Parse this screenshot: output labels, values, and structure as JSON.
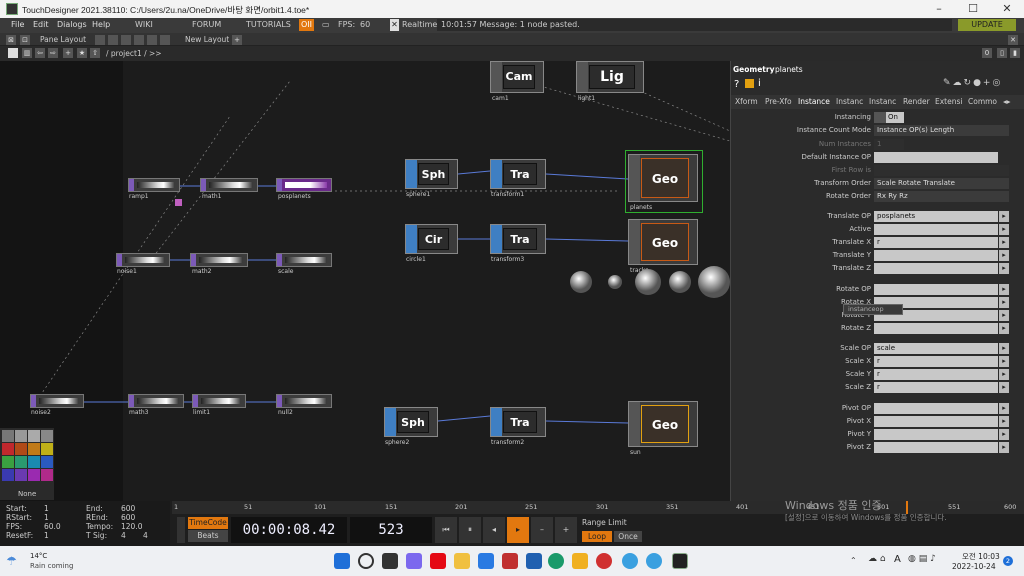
{
  "app": {
    "title": "TouchDesigner 2021.38110: C:/Users/2u.na/OneDrive/바탕 화면/orbit1.4.toe*"
  },
  "menu": {
    "items": [
      "File",
      "Edit",
      "Dialogs",
      "Help"
    ],
    "wiki": "WIKI",
    "forum": "FORUM",
    "tutorials": "TUTORIALS",
    "oii": "OII",
    "fps_label": "FPS:",
    "fps_value": "60",
    "realtime": "Realtime",
    "message": "10:01:57 Message: 1 node pasted.",
    "update": "UPDATE"
  },
  "toolbar": {
    "pane_layout": "Pane Layout",
    "new_layout": "New Layout",
    "path": "/ project1 / >>",
    "zero": "0"
  },
  "nodes": {
    "cam": "Cam",
    "cam_name": "cam1",
    "lig": "Lig",
    "lig_name": "light1",
    "sph1": "Sph",
    "sph1_name": "sphere1",
    "tra1": "Tra",
    "tra1_name": "transform1",
    "geo1": "Geo",
    "geo1_name": "planets",
    "cir": "Cir",
    "cir_name": "circle1",
    "tra3": "Tra",
    "tra3_name": "transform3",
    "geo2": "Geo",
    "geo2_name": "tracks",
    "sph2": "Sph",
    "sph2_name": "sphere2",
    "tra2": "Tra",
    "tra2_name": "transform2",
    "geo3": "Geo",
    "geo3_name": "sun",
    "ramp1": "ramp1",
    "math1": "math1",
    "posplanets": "posplanets",
    "noise1": "noise1",
    "math2": "math2",
    "scale": "scale",
    "noise2": "noise2",
    "math3": "math3",
    "limit1": "limit1",
    "null2": "null2"
  },
  "palette": {
    "none_label": "None"
  },
  "panel": {
    "header_type": "Geometry",
    "header_name": "planets",
    "tabs": [
      "Xform",
      "Pre-Xfo",
      "Instance",
      "Instanc",
      "Instanc",
      "Render",
      "Extensi",
      "Commo"
    ],
    "active_tab": "Instance",
    "params": [
      {
        "label": "Instancing",
        "value": "On"
      },
      {
        "label": "Instance Count Mode",
        "value": "Instance OP(s) Length"
      },
      {
        "label": "Num Instances",
        "value": "1"
      },
      {
        "label": "Default Instance OP",
        "value": ""
      },
      {
        "label": "First Row is",
        "value": ""
      },
      {
        "label": "Transform Order",
        "value": "Scale Rotate Translate"
      },
      {
        "label": "Rotate Order",
        "value": "Rx Ry Rz"
      },
      {
        "label": "Translate OP",
        "value": "posplanets"
      },
      {
        "label": "Active",
        "value": ""
      },
      {
        "label": "Translate X",
        "value": "r"
      },
      {
        "label": "Translate Y",
        "value": ""
      },
      {
        "label": "Translate Z",
        "value": ""
      },
      {
        "label": "Rotate OP",
        "value": ""
      },
      {
        "label": "Rotate X",
        "value": ""
      },
      {
        "label": "Rotate Y",
        "value": ""
      },
      {
        "label": "Rotate Z",
        "value": ""
      },
      {
        "label": "Scale OP",
        "value": "scale"
      },
      {
        "label": "Scale X",
        "value": "r"
      },
      {
        "label": "Scale Y",
        "value": "r"
      },
      {
        "label": "Scale Z",
        "value": "r"
      },
      {
        "label": "Pivot OP",
        "value": ""
      },
      {
        "label": "Pivot X",
        "value": ""
      },
      {
        "label": "Pivot Y",
        "value": ""
      },
      {
        "label": "Pivot Z",
        "value": ""
      }
    ],
    "tooltip": "instanceop"
  },
  "timeline": {
    "start_label": "Start:",
    "start": "1",
    "end_label": "End:",
    "end": "600",
    "rstart_label": "RStart:",
    "rstart": "1",
    "rend_label": "REnd:",
    "rend": "600",
    "fps_label": "FPS:",
    "fps": "60.0",
    "tempo_label": "Tempo:",
    "tempo": "120.0",
    "resetf_label": "ResetF:",
    "resetf": "1",
    "tsig_label": "T Sig:",
    "tsig_a": "4",
    "tsig_b": "4",
    "timecode_label": "TimeCode",
    "beats_label": "Beats",
    "timecode": "00:00:08.42",
    "frame": "523",
    "range_limit": "Range Limit",
    "loop": "Loop",
    "once": "Once",
    "ruler": [
      "1",
      "51",
      "101",
      "151",
      "201",
      "251",
      "301",
      "351",
      "401",
      "451",
      "501",
      "551",
      "600"
    ]
  },
  "watermark": {
    "line1": "Windows 정품 인증",
    "line2": "[설정]으로 이동하여 Windows를 정품 인증합니다."
  },
  "taskbar": {
    "temp": "14°C",
    "weather": "Rain coming",
    "time": "오전 10:03",
    "date": "2022-10-24",
    "notif": "2",
    "lang": "A"
  },
  "colors": {
    "accent_orange": "#e2780f",
    "top_purple": "#7c5ab8",
    "sop_blue": "#3f7fc3",
    "comp_gray": "#555555"
  }
}
